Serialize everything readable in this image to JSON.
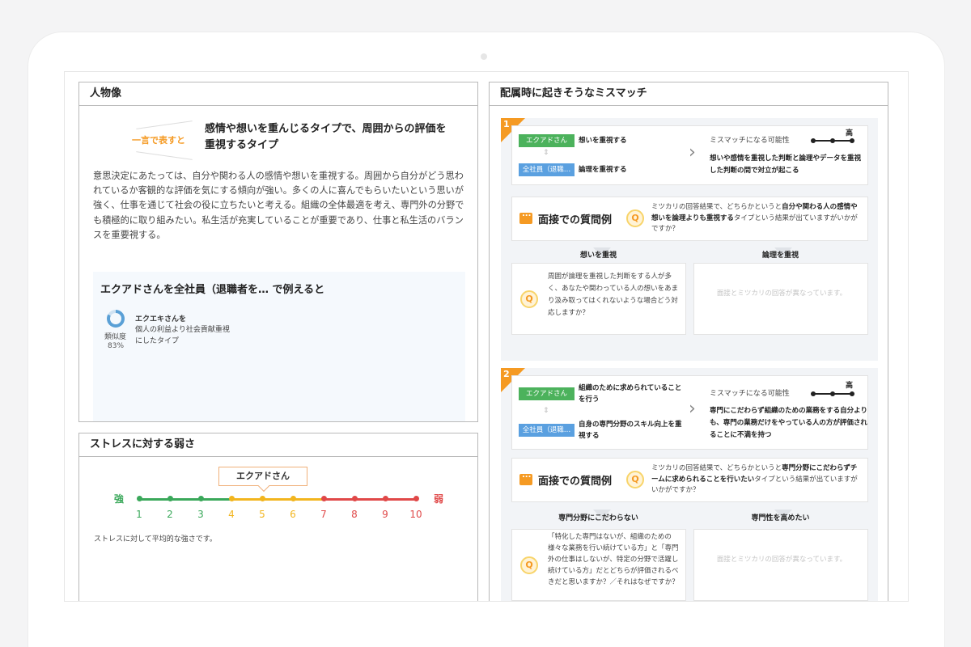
{
  "profile": {
    "title": "人物像",
    "summary_label": "一言で表すと",
    "summary_text": "感情や想いを重んじるタイプで、周囲からの評価を重視するタイプ",
    "description": "意思決定にあたっては、自分や関わる人の感情や想いを重視する。周囲から自分がどう思われているか客観的な評価を気にする傾向が強い。多くの人に喜んでもらいたいという思いが強く、仕事を通じて社会の役に立ちたいと考える。組織の全体最適を考え、専門外の分野でも積極的に取り組みたい。私生活が充実していることが重要であり、仕事と私生活のバランスを重要視する。",
    "example": {
      "title": "エクアドさんを全社員（退職者を… で例えると",
      "similarity_label": "類似度",
      "similarity_pct": "83%",
      "similarity_value": 0.83,
      "name": "エクエキさんを",
      "desc": "個人の利益より社会貢献重視にしたタイプ"
    }
  },
  "stress": {
    "title": "ストレスに対する弱さ",
    "marker": "エクアドさん",
    "marker_level": 5,
    "strong": "強",
    "weak": "弱",
    "scale": [
      "1",
      "2",
      "3",
      "4",
      "5",
      "6",
      "7",
      "8",
      "9",
      "10"
    ],
    "note": "ストレスに対して平均的な強さです。",
    "colors": {
      "green": "#3aa85a",
      "yellow": "#f2b51e",
      "red": "#e04848"
    }
  },
  "mismatch": {
    "title": "配属時に起きそうなミスマッチ",
    "prob_label": "ミスマッチになる可能性",
    "high": "高",
    "interview_title": "面接での質問例",
    "disabled_text": "面接とミツカリの回答が異なっています。",
    "items": [
      {
        "num": "1",
        "tag1": "エクアドさん",
        "text1": "想いを重視する",
        "tag2": "全社員（退職…",
        "text2": "論理を重視する",
        "result": "想いや感情を重視した判断と論理やデータを重視した判断の間で対立が起こる",
        "iv_pre": "ミツカリの回答結果で、どちらかというと",
        "iv_bold": "自分や関わる人の感情や想いを論理よりも重視する",
        "iv_post": "タイプという結果が出ていますがいかがですか？",
        "col_left": "想いを重視",
        "col_right": "論理を重視",
        "question": "周囲が論理を重視した判断をする人が多く、あなたや関わっている人の想いをあまり汲み取ってはくれないような場合どう対応しますか？"
      },
      {
        "num": "2",
        "tag1": "エクアドさん",
        "text1": "組織のために求められていることを行う",
        "tag2": "全社員（退職…",
        "text2": "自身の専門分野のスキル向上を重視する",
        "result": "専門にこだわらず組織のための業務をする自分よりも、専門の業務だけをやっている人の方が評価されることに不満を持つ",
        "iv_pre": "ミツカリの回答結果で、どちらかというと",
        "iv_bold": "専門分野にこだわらずチームに求められることを行いたい",
        "iv_post": "タイプという結果が出ていますがいかがですか？",
        "col_left": "専門分野にこだわらない",
        "col_right": "専門性を高めたい",
        "question": "「特化した専門はないが、組織のための様々な業務を行い続けている方」と「専門外の仕事はしないが、特定の分野で活躍し続けている方」だとどちらが評価されるべきだと思いますか？／それはなぜですか？"
      }
    ]
  }
}
